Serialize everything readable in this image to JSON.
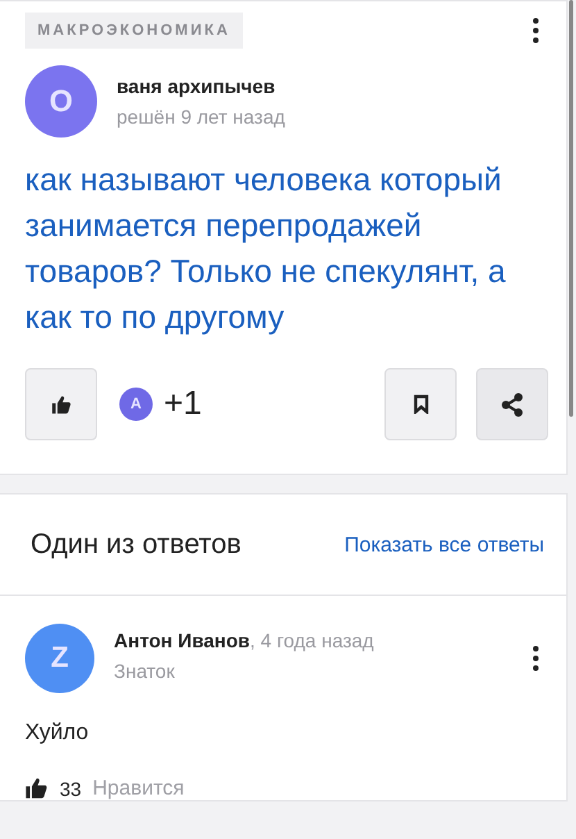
{
  "question": {
    "category": "МАКРОЭКОНОМИКА",
    "author": {
      "initial": "О",
      "name": "ваня архипычев",
      "status": "решён 9 лет назад"
    },
    "text": "как называют человека который занимается перепродажей товаров? Только не спекулянт, а как то по другому",
    "voters": {
      "initial": "A",
      "count": "+1"
    }
  },
  "answers_section": {
    "title": "Один из ответов",
    "show_all": "Показать все ответы"
  },
  "answer": {
    "initial": "Z",
    "name": "Антон Иванов",
    "time": ", 4 года назад",
    "rank": "Знаток",
    "text": "Хуйло",
    "likes": "33",
    "like_label": "Нравится"
  }
}
